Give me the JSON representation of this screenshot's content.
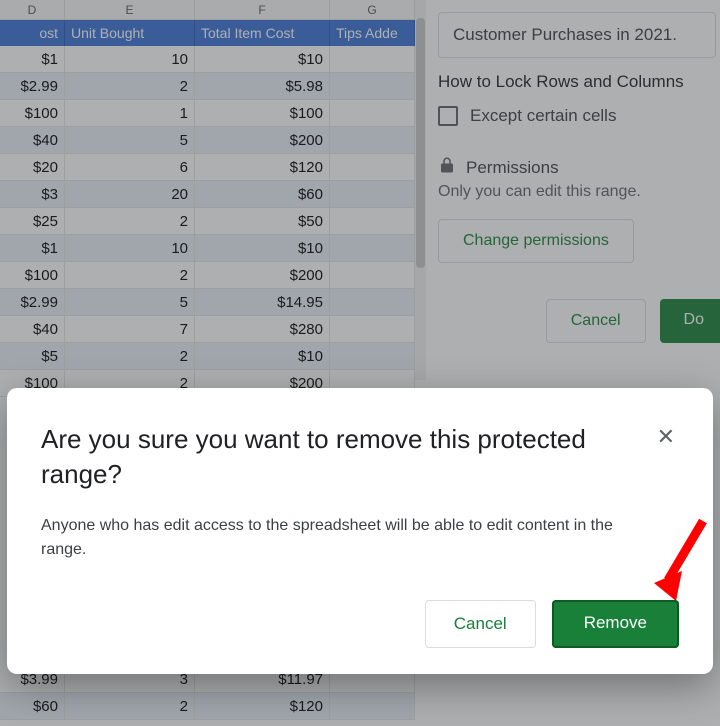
{
  "columns": {
    "letters": {
      "D": "D",
      "E": "E",
      "F": "F",
      "G": "G"
    },
    "headers": {
      "D": "ost",
      "E": "Unit Bought",
      "F": "Total Item Cost",
      "G": "Tips Adde"
    }
  },
  "rows": [
    {
      "cost": "$1",
      "units": "10",
      "total": "$10"
    },
    {
      "cost": "$2.99",
      "units": "2",
      "total": "$5.98"
    },
    {
      "cost": "$100",
      "units": "1",
      "total": "$100"
    },
    {
      "cost": "$40",
      "units": "5",
      "total": "$200"
    },
    {
      "cost": "$20",
      "units": "6",
      "total": "$120"
    },
    {
      "cost": "$3",
      "units": "20",
      "total": "$60"
    },
    {
      "cost": "$25",
      "units": "2",
      "total": "$50"
    },
    {
      "cost": "$1",
      "units": "10",
      "total": "$10"
    },
    {
      "cost": "$100",
      "units": "2",
      "total": "$200"
    },
    {
      "cost": "$2.99",
      "units": "5",
      "total": "$14.95"
    },
    {
      "cost": "$40",
      "units": "7",
      "total": "$280"
    },
    {
      "cost": "$5",
      "units": "2",
      "total": "$10"
    },
    {
      "cost": "$100",
      "units": "2",
      "total": "$200"
    }
  ],
  "rows2": [
    {
      "cost": "$3.99",
      "units": "3",
      "total": "$11.97"
    },
    {
      "cost": "$60",
      "units": "2",
      "total": "$120"
    }
  ],
  "sidepanel": {
    "description": "Customer Purchases in 2021.",
    "link": "How to Lock Rows and Columns",
    "except": "Except certain cells",
    "permissions_header": "Permissions",
    "permissions_sub": "Only you can edit this range.",
    "change_btn": "Change permissions",
    "cancel": "Cancel",
    "done": "Do"
  },
  "dialog": {
    "title": "Are you sure you want to remove this protected range?",
    "body": "Anyone who has edit access to the spreadsheet will be able to edit content in the range.",
    "cancel": "Cancel",
    "remove": "Remove"
  }
}
